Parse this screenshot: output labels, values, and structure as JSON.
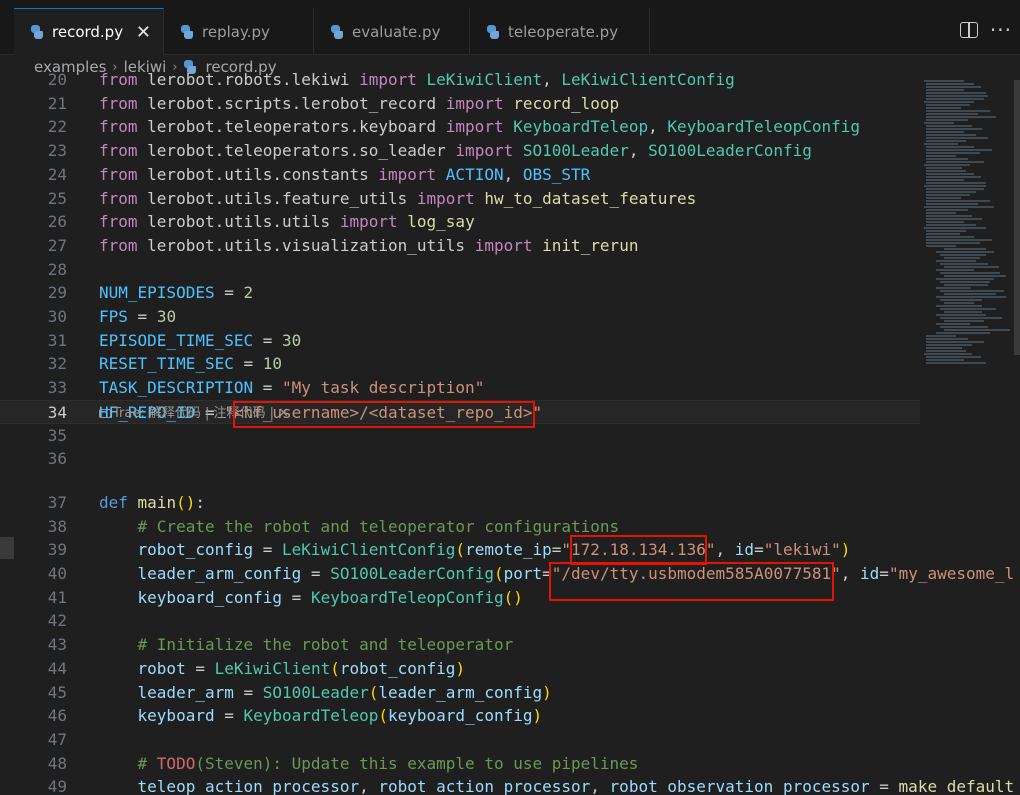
{
  "tabs": [
    {
      "label": "record.py",
      "active": true
    },
    {
      "label": "replay.py",
      "active": false
    },
    {
      "label": "evaluate.py",
      "active": false
    },
    {
      "label": "teleoperate.py",
      "active": false
    }
  ],
  "breadcrumb": [
    "examples",
    "lekiwi",
    "record.py"
  ],
  "codelens": "Trae: 解释代码 | 注释代码 | ✕",
  "lines": [
    {
      "n": "20",
      "html": "<span class='kw'>from</span> lerobot.robots.lekiwi <span class='kw'>import</span> <span class='cls'>LeKiwiClient</span>, <span class='cls'>LeKiwiClientConfig</span>"
    },
    {
      "n": "21",
      "html": "<span class='kw'>from</span> lerobot.scripts.lerobot_record <span class='kw'>import</span> <span class='fn'>record_loop</span>"
    },
    {
      "n": "22",
      "html": "<span class='kw'>from</span> lerobot.teleoperators.keyboard <span class='kw'>import</span> <span class='cls'>KeyboardTeleop</span>, <span class='cls'>KeyboardTeleopConfig</span>"
    },
    {
      "n": "23",
      "html": "<span class='kw'>from</span> lerobot.teleoperators.so_leader <span class='kw'>import</span> <span class='cls'>SO100Leader</span>, <span class='cls'>SO100LeaderConfig</span>"
    },
    {
      "n": "24",
      "html": "<span class='kw'>from</span> lerobot.utils.constants <span class='kw'>import</span> <span class='const'>ACTION</span>, <span class='const'>OBS_STR</span>"
    },
    {
      "n": "25",
      "html": "<span class='kw'>from</span> lerobot.utils.feature_utils <span class='kw'>import</span> <span class='fn'>hw_to_dataset_features</span>"
    },
    {
      "n": "26",
      "html": "<span class='kw'>from</span> lerobot.utils.utils <span class='kw'>import</span> <span class='fn'>log_say</span>"
    },
    {
      "n": "27",
      "html": "<span class='kw'>from</span> lerobot.utils.visualization_utils <span class='kw'>import</span> <span class='fn'>init_rerun</span>"
    },
    {
      "n": "28",
      "html": ""
    },
    {
      "n": "29",
      "html": "<span class='const'>NUM_EPISODES</span> = <span class='num'>2</span>"
    },
    {
      "n": "30",
      "html": "<span class='const'>FPS</span> = <span class='num'>30</span>"
    },
    {
      "n": "31",
      "html": "<span class='const'>EPISODE_TIME_SEC</span> = <span class='num'>30</span>"
    },
    {
      "n": "32",
      "html": "<span class='const'>RESET_TIME_SEC</span> = <span class='num'>10</span>"
    },
    {
      "n": "33",
      "html": "<span class='const'>TASK_DESCRIPTION</span> = <span class='str'>\"My task description\"</span>"
    },
    {
      "n": "34",
      "html": "<span class='const'>HF_REPO_ID</span> = <span class='str'>\"&lt;hf_username&gt;/&lt;dataset_repo_id&gt;\"</span>",
      "current": true
    },
    {
      "n": "35",
      "html": ""
    },
    {
      "n": "36",
      "html": ""
    },
    {
      "n": "37",
      "html": "<span class='kw2'>def</span> <span class='fn'>main</span><span class='pl'>()</span>:"
    },
    {
      "n": "38",
      "html": "    <span class='com'># Create the robot and teleoperator configurations</span>"
    },
    {
      "n": "39",
      "html": "    <span class='var'>robot_config</span> = <span class='cls'>LeKiwiClientConfig</span><span class='pl'>(</span><span class='param'>remote_ip</span>=<span class='str'>\"172.18.134.136\"</span>, <span class='param'>id</span>=<span class='str'>\"lekiwi\"</span><span class='pl'>)</span>"
    },
    {
      "n": "40",
      "html": "    <span class='var'>leader_arm_config</span> = <span class='cls'>SO100LeaderConfig</span><span class='pl'>(</span><span class='param'>port</span>=<span class='str'>\"/dev/tty.usbmodem585A0077581\"</span>, <span class='param'>id</span>=<span class='str'>\"my_awesome_l</span>"
    },
    {
      "n": "41",
      "html": "    <span class='var'>keyboard_config</span> = <span class='cls'>KeyboardTeleopConfig</span><span class='pl'>()</span>"
    },
    {
      "n": "42",
      "html": ""
    },
    {
      "n": "43",
      "html": "    <span class='com'># Initialize the robot and teleoperator</span>"
    },
    {
      "n": "44",
      "html": "    <span class='var'>robot</span> = <span class='cls'>LeKiwiClient</span><span class='pl'>(</span><span class='var'>robot_config</span><span class='pl'>)</span>"
    },
    {
      "n": "45",
      "html": "    <span class='var'>leader_arm</span> = <span class='cls'>SO100Leader</span><span class='pl'>(</span><span class='var'>leader_arm_config</span><span class='pl'>)</span>"
    },
    {
      "n": "46",
      "html": "    <span class='var'>keyboard</span> = <span class='cls'>KeyboardTeleop</span><span class='pl'>(</span><span class='var'>keyboard_config</span><span class='pl'>)</span>"
    },
    {
      "n": "47",
      "html": ""
    },
    {
      "n": "48",
      "html": "    <span class='com'># </span><span class='todo'>TODO</span><span class='com'>(Steven): Update this example to use pipelines</span>"
    },
    {
      "n": "49",
      "html": "    <span class='var'>teleop_action_processor</span>, <span class='var'>robot_action_processor</span>, <span class='var'>robot_observation_processor</span> = <span class='fn'>make_default</span>"
    }
  ]
}
